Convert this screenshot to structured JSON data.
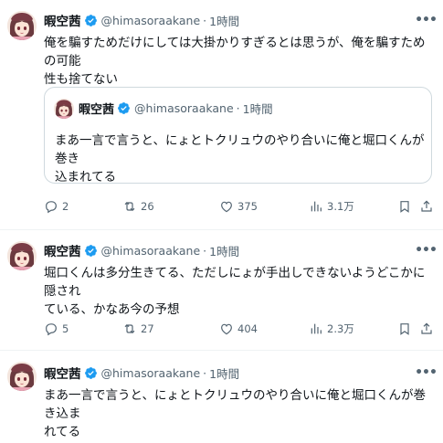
{
  "tweets": [
    {
      "author_name": "暇空茜",
      "handle": "@himasoraakane",
      "dot": "·",
      "time": "1時間",
      "text_line1": "俺を騙すためだけにしては大掛かりすぎるとは思うが、俺を騙すための可能",
      "text_line2": "性も捨てない",
      "quote": {
        "author_name": "暇空茜",
        "handle": "@himasoraakane",
        "dot": "·",
        "time": "1時間",
        "text_line1": "まあ一言で言うと、にょとトクリュウのやり合いに俺と堀口くんが巻き",
        "text_line2": "込まれてる"
      },
      "replies": "2",
      "reposts": "26",
      "likes": "375",
      "views": "3.1万"
    },
    {
      "author_name": "暇空茜",
      "handle": "@himasoraakane",
      "dot": "·",
      "time": "1時間",
      "text_line1": "堀口くんは多分生きてる、ただしにょが手出しできないようどこかに隠され",
      "text_line2": "ている、かなあ今の予想",
      "replies": "5",
      "reposts": "27",
      "likes": "404",
      "views": "2.3万"
    },
    {
      "author_name": "暇空茜",
      "handle": "@himasoraakane",
      "dot": "·",
      "time": "1時間",
      "text_line1": "まあ一言で言うと、にょとトクリュウのやり合いに俺と堀口くんが巻き込ま",
      "text_line2": "れてる"
    }
  ],
  "colors": {
    "verified": "#1d9bf0",
    "secondary_text": "#536471",
    "border": "#cfd9de"
  },
  "icons": [
    "more-icon",
    "verified-badge-icon",
    "reply-icon",
    "repost-icon",
    "like-icon",
    "views-icon",
    "bookmark-icon",
    "share-icon"
  ]
}
